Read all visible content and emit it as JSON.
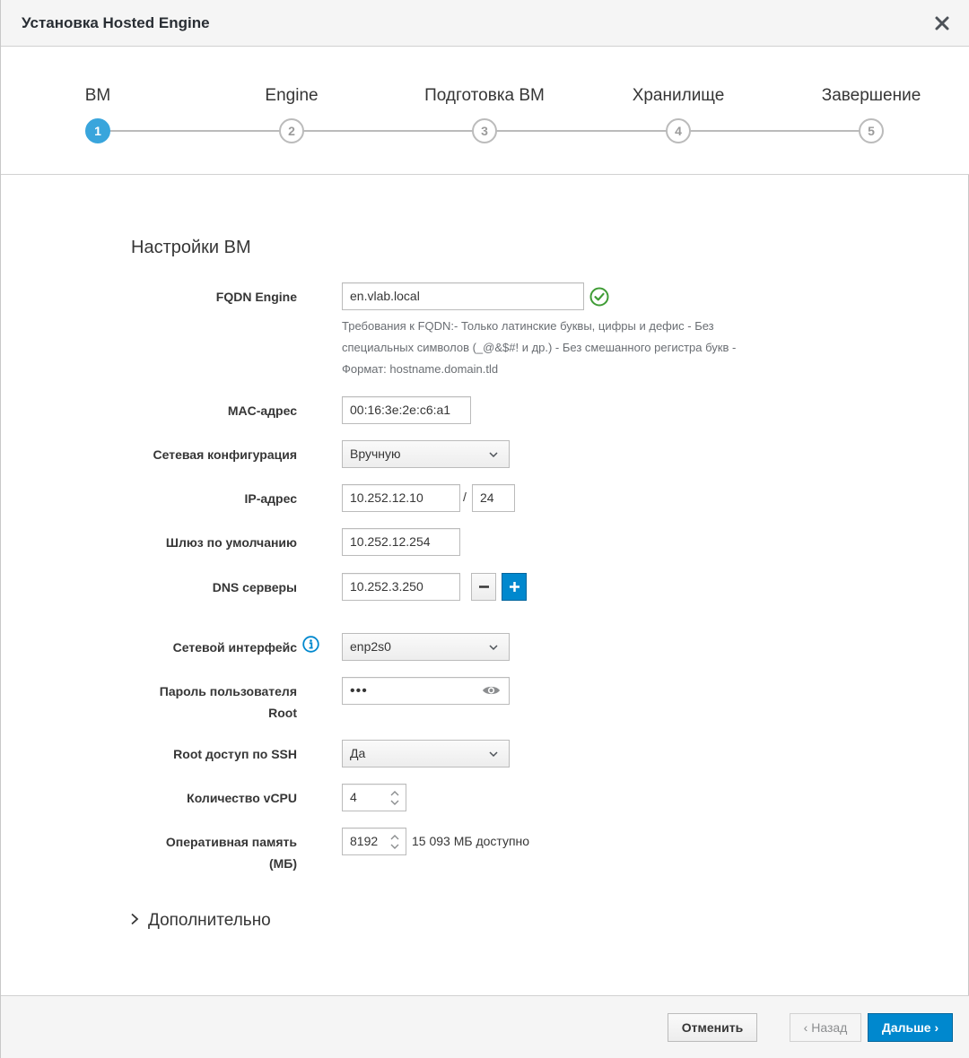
{
  "header": {
    "title": "Установка Hosted Engine"
  },
  "steps": [
    {
      "number": "1",
      "label": "ВМ"
    },
    {
      "number": "2",
      "label": "Engine"
    },
    {
      "number": "3",
      "label": "Подготовка ВМ"
    },
    {
      "number": "4",
      "label": "Хранилище"
    },
    {
      "number": "5",
      "label": "Завершение"
    }
  ],
  "form": {
    "section_title": "Настройки ВМ",
    "fqdn": {
      "label": "FQDN Engine",
      "value": "en.vlab.local",
      "help_line1": "Требования к FQDN:- Только латинские буквы, цифры и дефис - Без",
      "help_line2": "специальных символов (_@&$#! и др.) - Без смешанного регистра букв -",
      "help_line3": "Формат: hostname.domain.tld"
    },
    "mac": {
      "label": "MAC-адрес",
      "value": "00:16:3e:2e:c6:a1"
    },
    "network_config": {
      "label": "Сетевая конфигурация",
      "value": "Вручную"
    },
    "ip": {
      "label": "IP-адрес",
      "value": "10.252.12.10",
      "separator": "/",
      "prefix": "24"
    },
    "gateway": {
      "label": "Шлюз по умолчанию",
      "value": "10.252.12.254"
    },
    "dns": {
      "label": "DNS серверы",
      "value": "10.252.3.250"
    },
    "interface": {
      "label": "Сетевой интерфейс",
      "value": "enp2s0"
    },
    "root_password": {
      "label_line1": "Пароль пользователя",
      "label_line2": "Root",
      "value": "•••"
    },
    "ssh": {
      "label": "Root доступ по SSH",
      "value": "Да"
    },
    "vcpu": {
      "label": "Количество vCPU",
      "value": "4"
    },
    "memory": {
      "label_line1": "Оперативная память",
      "label_line2": "(МБ)",
      "value": "8192",
      "available": "15 093 МБ доступно"
    },
    "advanced": "Дополнительно"
  },
  "footer": {
    "cancel": "Отменить",
    "back": "‹ Назад",
    "next": "Дальше ›"
  },
  "colors": {
    "primary": "#0088ce",
    "active_step": "#39a5dc",
    "valid": "#3f9c35"
  }
}
